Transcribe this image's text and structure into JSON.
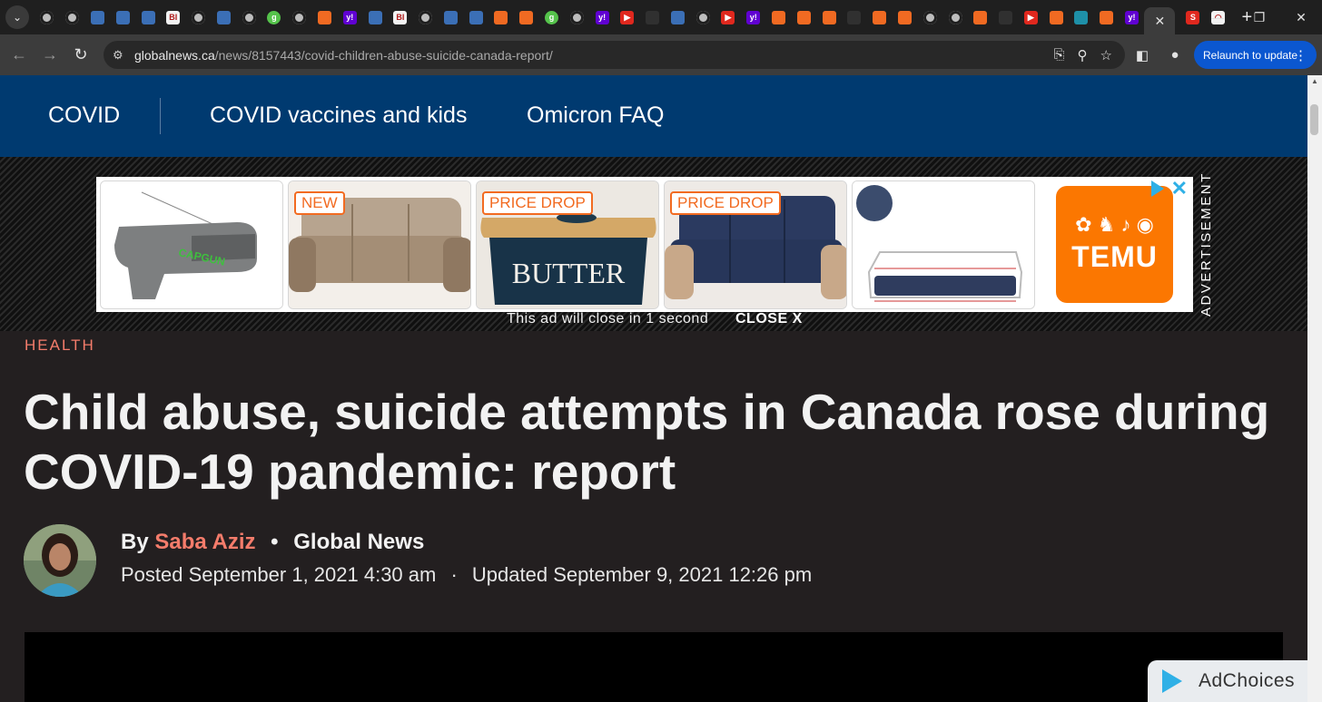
{
  "browser": {
    "tab_menu_icon": "chevron-down-icon",
    "active_tab_close": "✕",
    "new_tab_label": "+",
    "favicons": [
      "globe",
      "globe",
      "blue",
      "blue",
      "blue",
      "white",
      "globe",
      "blue",
      "globe",
      "green",
      "globe",
      "orange",
      "purple",
      "blue",
      "white",
      "globe",
      "blue",
      "blue",
      "orange",
      "orange",
      "green",
      "globe",
      "purple",
      "red",
      "dark",
      "blue",
      "globe",
      "red",
      "purple",
      "orange",
      "orange",
      "orange",
      "dark",
      "orange",
      "orange",
      "globe",
      "globe",
      "orange",
      "dark",
      "red",
      "orange",
      "teal",
      "orange",
      "purple"
    ],
    "favicon_glyphs": {
      "purple": "y!",
      "white": "BI",
      "green": "g",
      "red": "▶"
    },
    "window_controls": [
      "—",
      "❐",
      "✕"
    ],
    "nav": {
      "back": "←",
      "forward": "→",
      "reload": "↻"
    },
    "url_host": "globalnews.ca",
    "url_path": "/news/8157443/covid-children-abuse-suicide-canada-report/",
    "omnibox_icons": [
      "install-icon",
      "zoom-icon",
      "star-icon"
    ],
    "relaunch_label": "Relaunch to update",
    "menu_dots": "⋮"
  },
  "topics": [
    {
      "label": "COVID"
    },
    {
      "label": "COVID vaccines and kids"
    },
    {
      "label": "Omicron FAQ"
    }
  ],
  "ad": {
    "badges": [
      "NEW",
      "PRICE DROP",
      "PRICE DROP"
    ],
    "butter_text": "BUTTER",
    "capgun_text": "CAPGUN",
    "temu_text": "TEMU",
    "vertical_label": "ADVERTISEMENT",
    "countdown": "This ad will close in 1 second",
    "close_label": "CLOSE X"
  },
  "article": {
    "kicker": "HEALTH",
    "headline": "Child abuse, suicide attempts in Canada rose during COVID-19 pandemic: report",
    "by": "By",
    "author": "Saba Aziz",
    "source": "Global News",
    "posted": "Posted September 1, 2021 4:30 am",
    "updated": "Updated September 9, 2021 12:26 pm"
  },
  "adchoices": {
    "label": "AdChoices"
  },
  "colors": {
    "topic_bar": "#003a70",
    "accent": "#f47c6b",
    "page_bg": "#231f20",
    "temu": "#fb7701",
    "relaunch": "#0b57d0"
  }
}
